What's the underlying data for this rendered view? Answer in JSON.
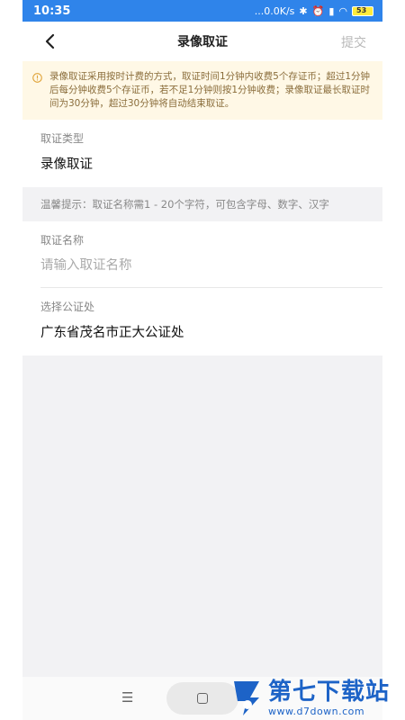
{
  "status_bar": {
    "time": "10:35",
    "speed": "...0.0K/s",
    "battery": "53"
  },
  "nav": {
    "title": "录像取证",
    "submit_label": "提交"
  },
  "notice": {
    "text": "录像取证采用按时计费的方式，取证时间1分钟内收费5个存证币；超过1分钟后每分钟收费5个存证币，若不足1分钟则按1分钟收费；录像取证最长取证时间为30分钟，超过30分钟将自动结束取证。"
  },
  "form": {
    "type_label": "取证类型",
    "type_value": "录像取证",
    "tip": "温馨提示：取证名称需1 - 20个字符，可包含字母、数字、汉字",
    "name_label": "取证名称",
    "name_placeholder": "请输入取证名称",
    "notary_label": "选择公证处",
    "notary_value": "广东省茂名市正大公证处"
  },
  "watermark": {
    "title": "第七下载站",
    "url": "www.d7down.com"
  },
  "colors": {
    "status_bar": "#2f84ea",
    "notice_bg": "#fff8e6",
    "notice_text": "#8a6d3b",
    "page_bg": "#f2f2f4",
    "watermark": "#1d63c7"
  }
}
